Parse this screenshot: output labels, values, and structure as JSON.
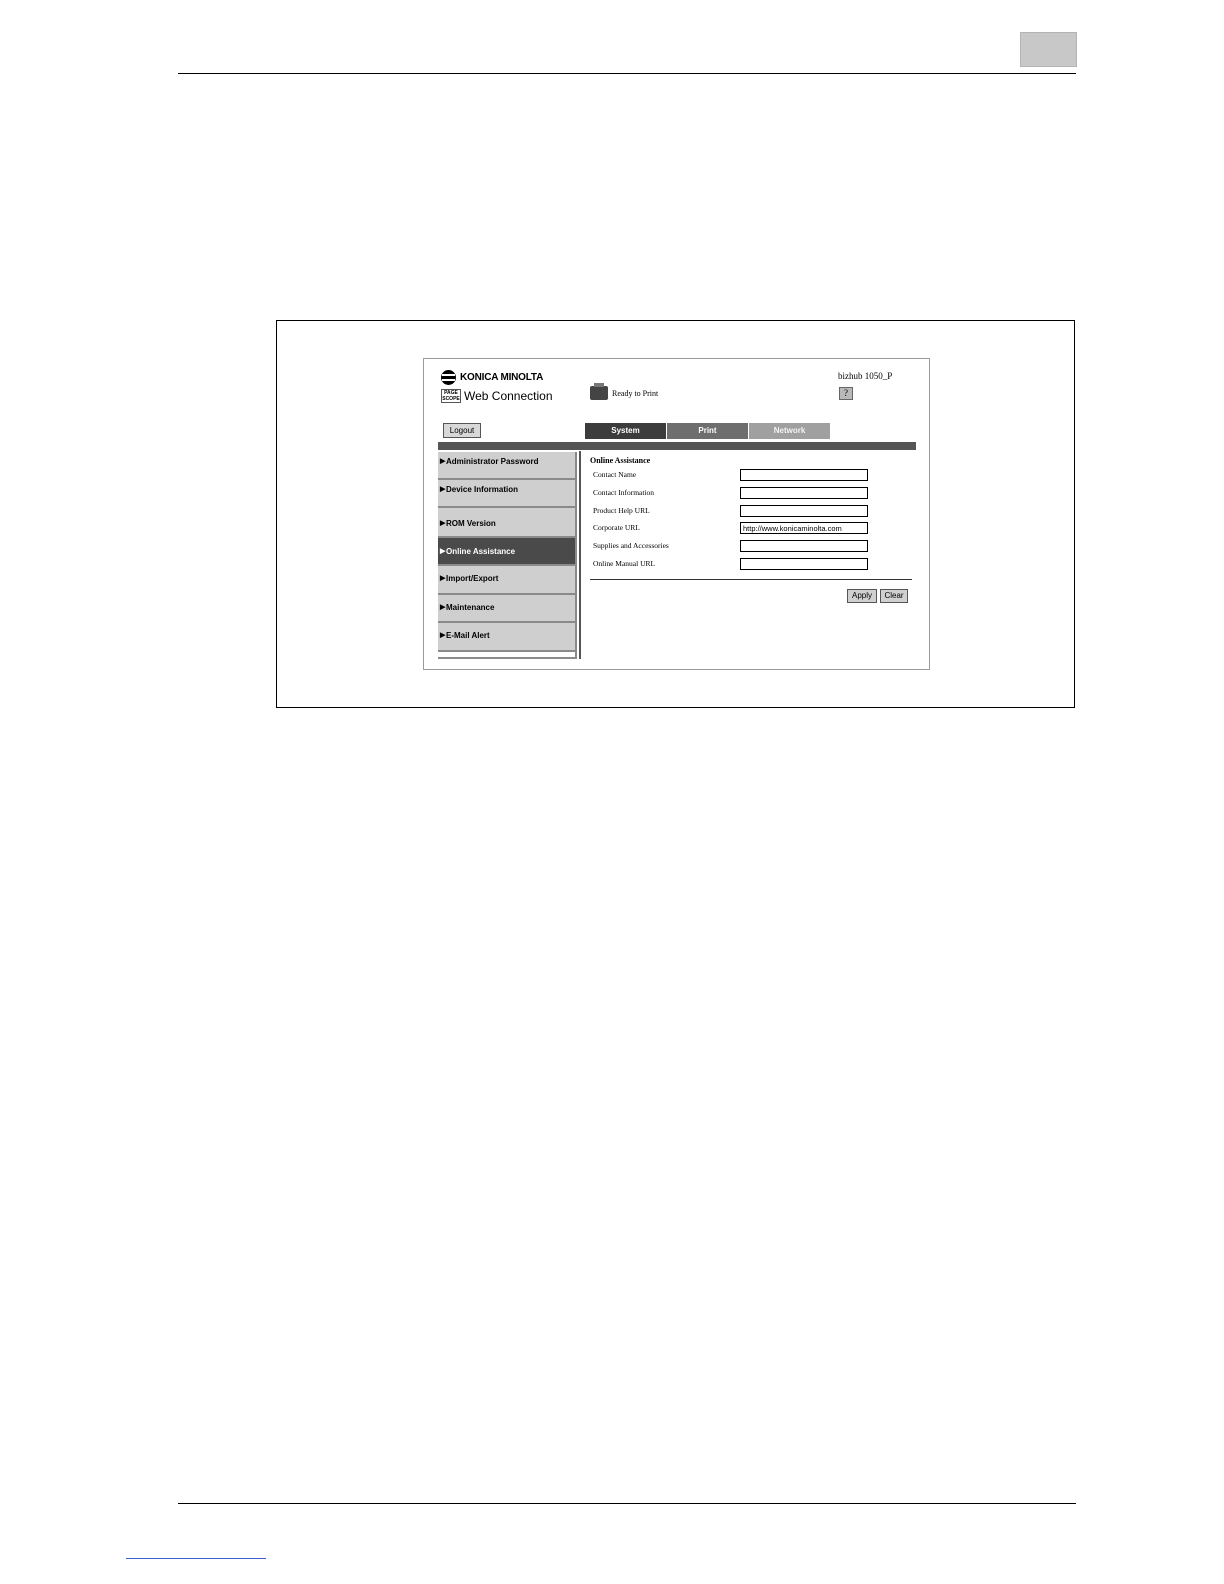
{
  "header": {
    "brand": "KONICA MINOLTA",
    "pagescope_mark": [
      "PAGE",
      "SCOPE"
    ],
    "product": "Web Connection",
    "status": "Ready to Print",
    "device_name": "bizhub 1050_P",
    "help_label": "?"
  },
  "toolbar": {
    "logout_label": "Logout"
  },
  "tabs": [
    {
      "label": "System"
    },
    {
      "label": "Print"
    },
    {
      "label": "Network"
    }
  ],
  "sidebar": {
    "arrow": "▶",
    "items": [
      {
        "label": "Administrator Password"
      },
      {
        "label": "Device Information"
      },
      {
        "label": "ROM Version"
      },
      {
        "label": "Online Assistance",
        "active": true
      },
      {
        "label": "Import/Export"
      },
      {
        "label": "Maintenance"
      },
      {
        "label": "E-Mail Alert"
      }
    ]
  },
  "content": {
    "title": "Online Assistance",
    "fields": [
      {
        "label": "Contact Name",
        "value": ""
      },
      {
        "label": "Contact Information",
        "value": ""
      },
      {
        "label": "Product Help URL",
        "value": ""
      },
      {
        "label": "Corporate URL",
        "value": "http://www.konicaminolta.com"
      },
      {
        "label": "Supplies and Accessories",
        "value": ""
      },
      {
        "label": "Online Manual URL",
        "value": ""
      }
    ],
    "apply_label": "Apply",
    "clear_label": "Clear"
  }
}
